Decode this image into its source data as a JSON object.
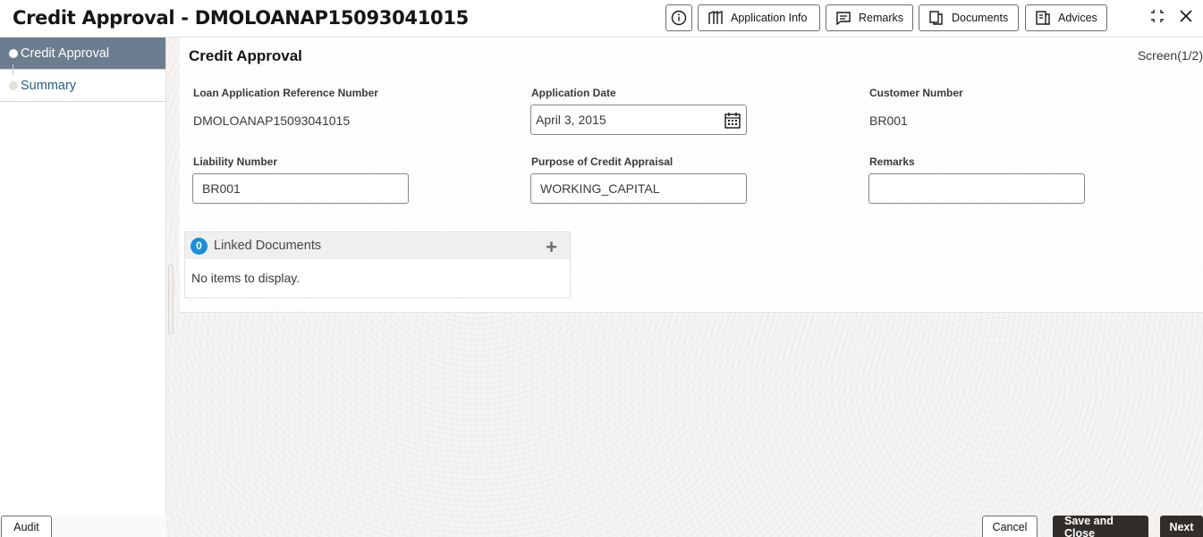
{
  "header": {
    "title": "Credit Approval - DMOLOANAP15093041015",
    "buttons": {
      "application_info": "Application Info",
      "remarks": "Remarks",
      "documents": "Documents",
      "advices": "Advices"
    },
    "icons": [
      "info-icon",
      "application-info-icon",
      "remarks-icon",
      "documents-icon",
      "advices-icon",
      "expand-icon",
      "close-icon"
    ]
  },
  "sidebar": {
    "items": [
      {
        "label": "Credit Approval",
        "active": true
      },
      {
        "label": "Summary",
        "active": false
      }
    ]
  },
  "main": {
    "section_title": "Credit Approval",
    "screen_indicator": "Screen(1/2)",
    "fields": {
      "loan_ref": {
        "label": "Loan Application Reference Number",
        "value": "DMOLOANAP15093041015"
      },
      "app_date": {
        "label": "Application Date",
        "value": "April 3, 2015"
      },
      "customer_number": {
        "label": "Customer Number",
        "value": "BR001"
      },
      "liability_number": {
        "label": "Liability Number",
        "value": "BR001"
      },
      "purpose": {
        "label": "Purpose of Credit Appraisal",
        "value": "WORKING_CAPITAL"
      },
      "remarks": {
        "label": "Remarks",
        "value": ""
      }
    },
    "linked_documents": {
      "count": "0",
      "title": "Linked Documents",
      "empty_text": "No items to display."
    }
  },
  "footer": {
    "audit": "Audit",
    "cancel": "Cancel",
    "save_close": "Save and Close",
    "next": "Next"
  },
  "colors": {
    "accent": "#1a8ed8",
    "sidebar_active": "#6b7d8e",
    "primary_button": "#312d2a"
  }
}
